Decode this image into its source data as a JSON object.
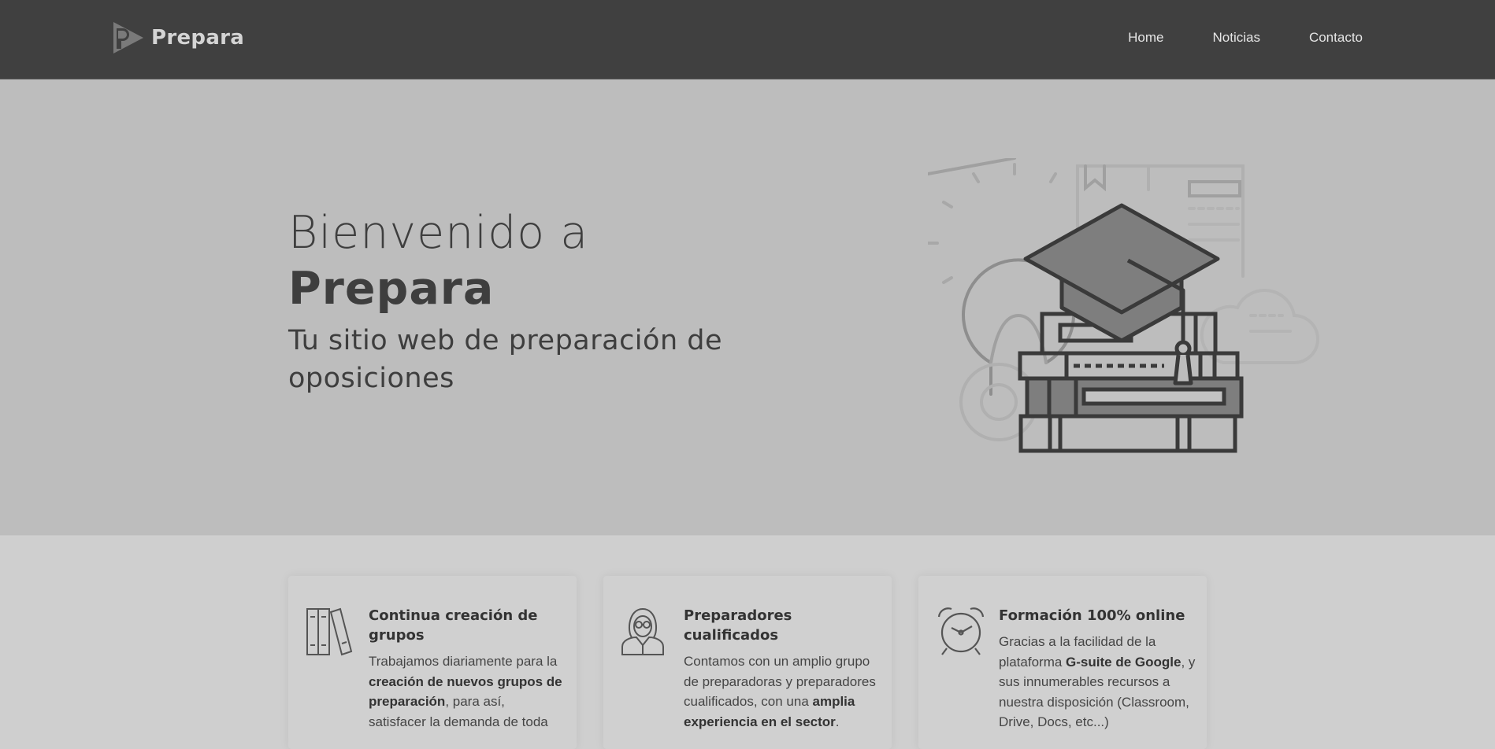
{
  "nav": {
    "brand": "Prepara",
    "links": [
      "Home",
      "Noticias",
      "Contacto"
    ]
  },
  "hero": {
    "line1": "Bienvenido a",
    "line2": "Prepara",
    "subtitle": "Tu sitio web de preparación de oposiciones"
  },
  "features": [
    {
      "icon": "books-icon",
      "title": "Continua creación de grupos",
      "t1": "Trabajamos diariamente para la ",
      "b1": "creación de nuevos grupos de preparación",
      "t2": ", para así, satisfacer la demanda de toda",
      "b2": "",
      "t3": ""
    },
    {
      "icon": "teacher-icon",
      "title": "Preparadores cualificados",
      "t1": "Contamos con un amplio grupo de preparadoras y preparadores cualificados, con una ",
      "b1": "amplia experiencia en el sector",
      "t2": ".",
      "b2": "",
      "t3": ""
    },
    {
      "icon": "alarm-clock-icon",
      "title": "Formación 100% online",
      "t1": "Gracias a la facilidad de la plataforma ",
      "b1": "G-suite de Google",
      "t2": ", y sus innumerables recursos a nuestra disposición (Classroom, Drive, Docs, etc...)",
      "b2": "",
      "t3": ""
    }
  ],
  "colors": {
    "navbar": "#404040",
    "hero": "#bdbdbd",
    "features": "#cfcfcf",
    "text": "#3e3e3e"
  }
}
